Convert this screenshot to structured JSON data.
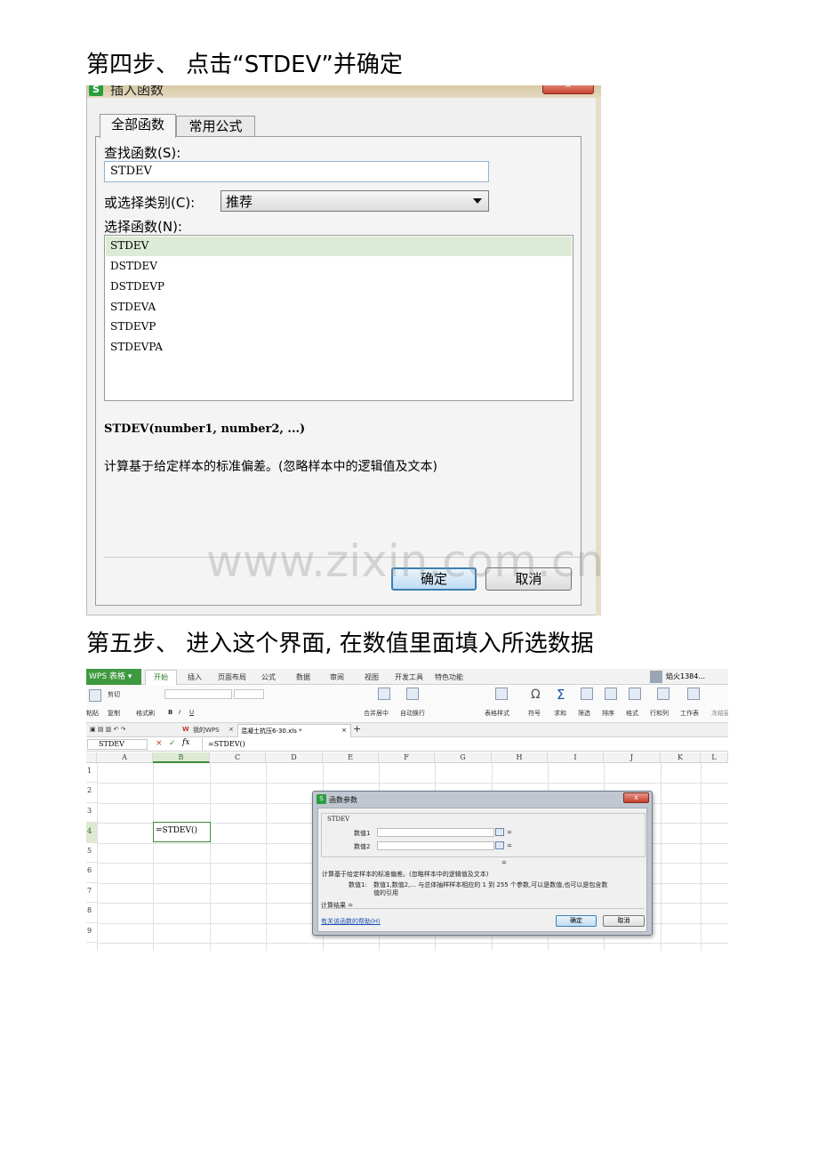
{
  "steps": {
    "step4": "第四步、 点击“STDEV”并确定",
    "step5": "第五步、 进入这个界面, 在数值里面填入所选数据"
  },
  "dialog1": {
    "title": "插入函数",
    "close": "x",
    "tabs": [
      "全部函数",
      "常用公式"
    ],
    "search_label": "查找函数(S):",
    "search_value": "STDEV",
    "category_label": "或选择类别(C):",
    "category_value": "推荐",
    "function_label": "选择函数(N):",
    "functions": [
      "STDEV",
      "DSTDEV",
      "DSTDEVP",
      "STDEVA",
      "STDEVP",
      "STDEVPA"
    ],
    "selected_function": "STDEV",
    "signature": "STDEV(number1, number2, ...)",
    "description": "计算基于给定样本的标准偏差。(忽略样本中的逻辑值及文本)",
    "ok": "确定",
    "cancel": "取消"
  },
  "watermark": "www.zixin.com.cn",
  "wps": {
    "app_label": "WPS 表格",
    "ribbon_tabs": [
      "开始",
      "插入",
      "页面布局",
      "公式",
      "数据",
      "审阅",
      "视图",
      "开发工具",
      "特色功能"
    ],
    "user": "焰火1384...",
    "ribbon": {
      "paste": "粘贴",
      "cut": "剪切",
      "copy": "复制",
      "format_painter": "格式刷",
      "merge_center": "合并居中",
      "auto_wrap": "自动换行",
      "table_style": "表格样式",
      "symbol": "符号",
      "sum": "求和",
      "filter": "筛选",
      "sort": "排序",
      "format": "格式",
      "row_col": "行和列",
      "worksheet": "工作表",
      "freeze": "冻结窗"
    },
    "doc_tabs": {
      "my_wps": "我的WPS",
      "file": "混凝土抗压6-30.xls *"
    },
    "name_box": "STDEV",
    "formula": "=STDEV()",
    "columns": [
      "A",
      "B",
      "C",
      "D",
      "E",
      "F",
      "G",
      "H",
      "I",
      "J",
      "K",
      "L"
    ],
    "rows": [
      "1",
      "2",
      "3",
      "4",
      "5",
      "6",
      "7",
      "8",
      "9"
    ],
    "active_cell_value": "=STDEV()",
    "active_cell_ref": "B4"
  },
  "dialog2": {
    "title": "函数参数",
    "close": "x",
    "function_name": "STDEV",
    "arg1_label": "数值1",
    "arg2_label": "数值2",
    "equals": "=",
    "description": "计算基于给定样本的标准偏差。(忽略样本中的逻辑值及文本)",
    "arg_help_label": "数值1:",
    "arg_help_text": "数值1,数值2,... 与总体抽样样本相应的 1 到 255 个参数,可以是数值,也可以是包含数",
    "arg_help_text2": "值的引用",
    "result_label": "计算结果 =",
    "help_link": "有关该函数的帮助(H)",
    "ok": "确定",
    "cancel": "取消"
  }
}
